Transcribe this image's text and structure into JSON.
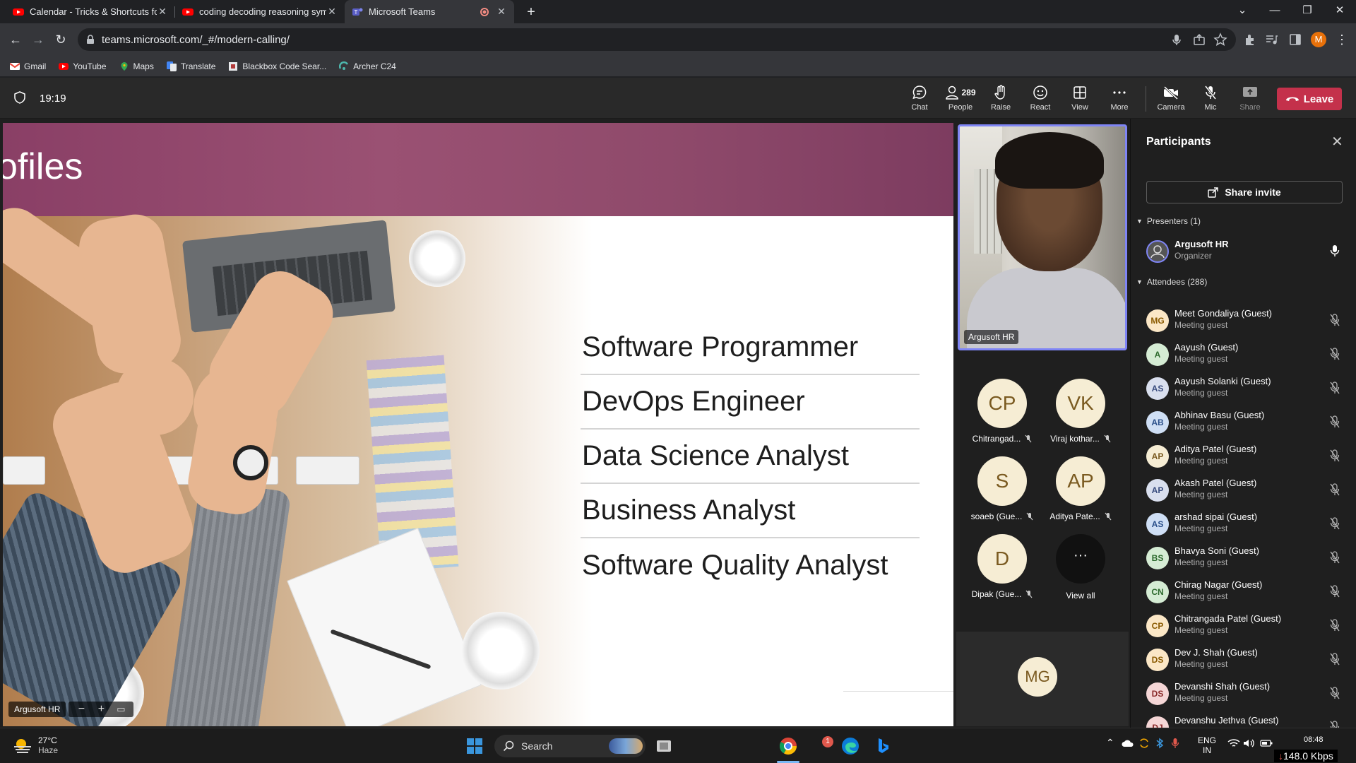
{
  "browser": {
    "tabs": [
      {
        "title": "Calendar - Tricks & Shortcuts for",
        "icon": "youtube-icon",
        "active": false
      },
      {
        "title": "coding decoding reasoning symb",
        "icon": "youtube-icon",
        "active": false
      },
      {
        "title": "Microsoft Teams",
        "icon": "teams-icon",
        "active": true,
        "recording": true
      }
    ],
    "url": "teams.microsoft.com/_#/modern-calling/",
    "profile_initial": "M",
    "bookmarks": [
      "Gmail",
      "YouTube",
      "Maps",
      "Translate",
      "Blackbox Code Sear...",
      "Archer C24"
    ]
  },
  "meeting": {
    "time": "19:19",
    "controls": {
      "chat": "Chat",
      "people": "People",
      "people_count": "289",
      "raise": "Raise",
      "react": "React",
      "view": "View",
      "more": "More",
      "camera": "Camera",
      "mic": "Mic",
      "share": "Share",
      "leave": "Leave"
    }
  },
  "slide": {
    "title_fragment": "ofiles",
    "roles": [
      "Software Programmer",
      "DevOps Engineer",
      "Data Science Analyst",
      "Business Analyst",
      "Software Quality Analyst"
    ],
    "presenter_label": "Argusoft HR",
    "zoom_out": "−",
    "zoom_in": "+"
  },
  "gallery": {
    "camera_name": "Argusoft HR",
    "tiles": [
      {
        "initials": "CP",
        "name": "Chitrangad..."
      },
      {
        "initials": "VK",
        "name": "Viraj kothar..."
      },
      {
        "initials": "S",
        "name": "soaeb (Gue..."
      },
      {
        "initials": "AP",
        "name": "Aditya Pate..."
      },
      {
        "initials": "D",
        "name": "Dipak (Gue..."
      }
    ],
    "view_all_glyph": "···",
    "view_all": "View all",
    "bottom_tile": "MG"
  },
  "participants": {
    "title": "Participants",
    "share_invite": "Share invite",
    "presenters_header": "Presenters (1)",
    "presenters": [
      {
        "name": "Argusoft HR",
        "role": "Organizer"
      }
    ],
    "attendees_header": "Attendees (288)",
    "attendees": [
      {
        "initials": "MG",
        "name": "Meet Gondaliya (Guest)",
        "role": "Meeting guest",
        "bg": "#fbe7c6",
        "fg": "#8a5a00"
      },
      {
        "initials": "A",
        "name": "Aayush (Guest)",
        "role": "Meeting guest",
        "bg": "#d5ecd4",
        "fg": "#2d6a2e"
      },
      {
        "initials": "AS",
        "name": "Aayush Solanki (Guest)",
        "role": "Meeting guest",
        "bg": "#d9dfee",
        "fg": "#394c7e"
      },
      {
        "initials": "AB",
        "name": "Abhinav Basu (Guest)",
        "role": "Meeting guest",
        "bg": "#cfdff5",
        "fg": "#2a4f8a"
      },
      {
        "initials": "AP",
        "name": "Aditya Patel (Guest)",
        "role": "Meeting guest",
        "bg": "#f6edd4",
        "fg": "#7a5a20"
      },
      {
        "initials": "AP",
        "name": "Akash Patel (Guest)",
        "role": "Meeting guest",
        "bg": "#d9dfee",
        "fg": "#394c7e"
      },
      {
        "initials": "AS",
        "name": "arshad sipai (Guest)",
        "role": "Meeting guest",
        "bg": "#cfdff5",
        "fg": "#2a4f8a"
      },
      {
        "initials": "BS",
        "name": "Bhavya Soni (Guest)",
        "role": "Meeting guest",
        "bg": "#d5ecd4",
        "fg": "#2d6a2e"
      },
      {
        "initials": "CN",
        "name": "Chirag Nagar (Guest)",
        "role": "Meeting guest",
        "bg": "#d5ecd4",
        "fg": "#2d6a2e"
      },
      {
        "initials": "CP",
        "name": "Chitrangada Patel (Guest)",
        "role": "Meeting guest",
        "bg": "#fbe7c6",
        "fg": "#8a5a00"
      },
      {
        "initials": "DS",
        "name": "Dev J. Shah (Guest)",
        "role": "Meeting guest",
        "bg": "#fbe7c6",
        "fg": "#8a5a00"
      },
      {
        "initials": "DS",
        "name": "Devanshi Shah (Guest)",
        "role": "Meeting guest",
        "bg": "#f5d6d6",
        "fg": "#8a2a2a"
      },
      {
        "initials": "DJ",
        "name": "Devanshu Jethva (Guest)",
        "role": "Meeting guest",
        "bg": "#f5d6d6",
        "fg": "#8a2a2a"
      }
    ]
  },
  "taskbar": {
    "temperature": "27°C",
    "condition": "Haze",
    "search": "Search",
    "badge": "1",
    "lang1": "ENG",
    "lang2": "IN",
    "time": "08:48",
    "netspeed": "148.0 Kbps"
  },
  "colors": {
    "accent": "#7f85f5",
    "leave": "#c4314b",
    "banner": "#8a3f66"
  }
}
